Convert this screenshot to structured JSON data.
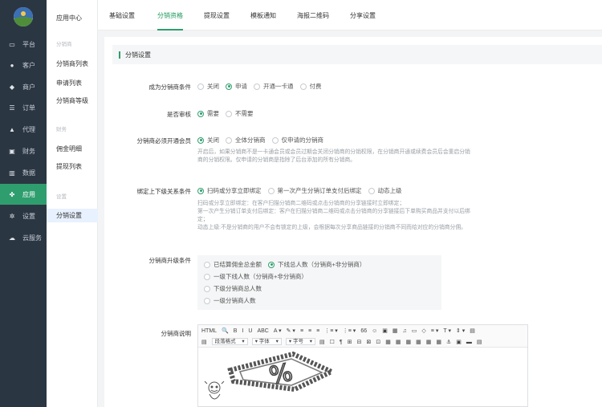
{
  "sidebar": {
    "items": [
      {
        "label": "平台",
        "icon": "monitor-icon",
        "glyph": "▭"
      },
      {
        "label": "客户",
        "icon": "user-icon",
        "glyph": "●"
      },
      {
        "label": "商户",
        "icon": "users-icon",
        "glyph": "◆"
      },
      {
        "label": "订单",
        "icon": "list-icon",
        "glyph": "☰"
      },
      {
        "label": "代理",
        "icon": "map-icon",
        "glyph": "▲"
      },
      {
        "label": "财务",
        "icon": "wallet-icon",
        "glyph": "▣"
      },
      {
        "label": "数据",
        "icon": "chart-icon",
        "glyph": "▥"
      },
      {
        "label": "应用",
        "icon": "apps-icon",
        "glyph": "✤"
      },
      {
        "label": "设置",
        "icon": "gear-icon",
        "glyph": "✲"
      },
      {
        "label": "云服务",
        "icon": "cloud-icon",
        "glyph": "☁"
      }
    ],
    "active_index": 7,
    "active_color": "#2f9e6e"
  },
  "submenu": {
    "title": "应用中心",
    "groups": [
      {
        "label": "分销商",
        "items": [
          "分销商列表",
          "申请列表",
          "分销商等级"
        ]
      },
      {
        "label": "财务",
        "items": [
          "佣金明细",
          "提现列表"
        ]
      },
      {
        "label": "设置",
        "items": [
          "分销设置"
        ]
      }
    ],
    "active_item": "分销设置"
  },
  "tabs": [
    "基础设置",
    "分销资格",
    "提现设置",
    "模板通知",
    "海报二维码",
    "分享设置"
  ],
  "active_tab": 1,
  "section_title": "分销设置",
  "form": {
    "condition": {
      "label": "成为分销商条件",
      "options": [
        "关闭",
        "申请",
        "开通一卡通",
        "付费"
      ],
      "selected": 1
    },
    "audit": {
      "label": "是否审核",
      "options": [
        "需要",
        "不需要"
      ],
      "selected": 0
    },
    "member": {
      "label": "分销商必须开通会员",
      "options": [
        "关闭",
        "全体分销商",
        "仅申请的分销商"
      ],
      "selected": 0,
      "help": [
        "开启后，如果分销商不是一卡通会员或会员过期会关闭分销商的分销权限，在分销商开通或续费会员后会重启分销",
        "商的分销权限。仅申请的分销商是指除了后台添加的所有分销商。"
      ]
    },
    "bind": {
      "label": "绑定上下级关系条件",
      "options": [
        "扫码或分享立即绑定",
        "第一次产生分销订单支付后绑定",
        "动态上级"
      ],
      "selected": 0,
      "help": [
        "扫码或分享立即绑定：在客户扫描分销商二维码或点击分销商的分享链接时立即绑定；",
        "第一次产生分销订单支付后绑定：客户在扫描分销商二维码或点击分销商的分享链接后下单购买商品并支付以后绑",
        "定；",
        "动态上级:不是分销商的用户不会有锁定的上级，会根据每次分享商品链接的分销商不同而给对应的分销商分佣。"
      ]
    },
    "upgrade": {
      "label": "分销商升级条件",
      "options": [
        "已结算佣金总金额",
        "下线总人数（分销商+非分销商）",
        "一级下线人数（分销商+非分销商）",
        "下级分销商总人数",
        "一级分销商人数"
      ],
      "selected": 1
    },
    "desc": {
      "label": "分销商说明"
    }
  },
  "editor": {
    "toolbar_row1": [
      "HTML",
      "🔍",
      "B",
      "I",
      "U",
      "ABC",
      "A ▾",
      "✎ ▾",
      "≡",
      "≡",
      "≡",
      "⋮≡ ▾",
      "⋮≡ ▾",
      "66",
      "☺",
      "▣",
      "▦",
      "♫",
      "▭",
      "◇",
      "≡ ▾",
      "T ▾",
      "⇕ ▾",
      "▤"
    ],
    "toolbar_row2_left": "▤",
    "paragraph_select": "段落格式",
    "font_select": "字体",
    "size_select": "字号",
    "toolbar_row2": [
      "▤",
      "☐",
      "¶",
      "⊞",
      "⊟",
      "⊠",
      "⊡",
      "▦",
      "▦",
      "▦",
      "▦",
      "▦",
      "▦",
      "⚓",
      "▣",
      "▬",
      "▤"
    ]
  }
}
